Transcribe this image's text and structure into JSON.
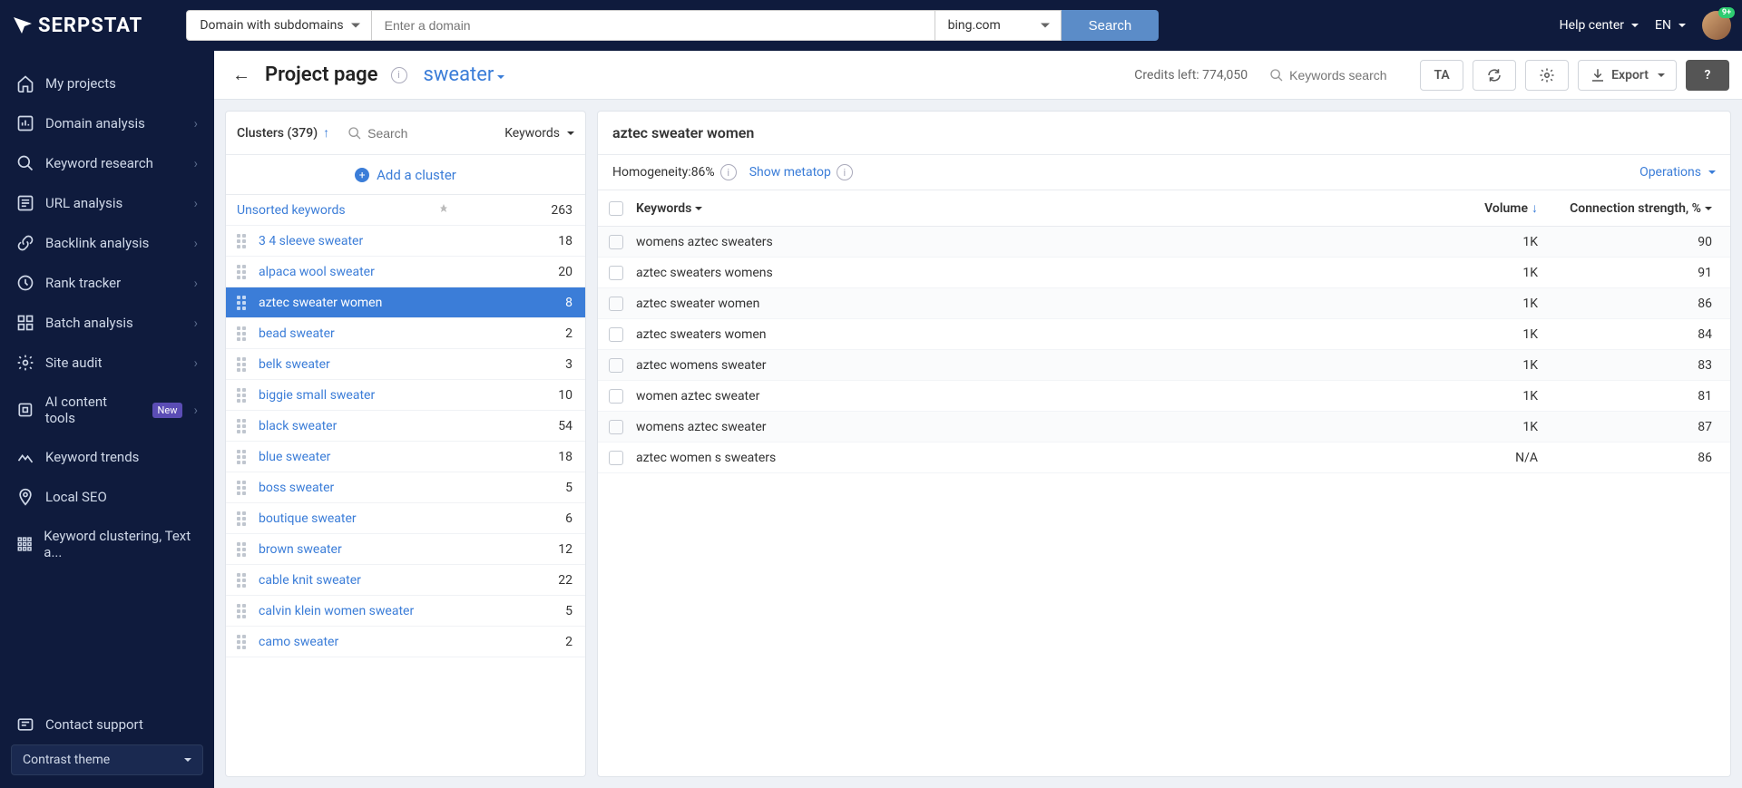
{
  "topbar": {
    "logo": "SERPSTAT",
    "domain_mode": "Domain with subdomains",
    "domain_placeholder": "Enter a domain",
    "engine": "bing.com",
    "search_btn": "Search",
    "help": "Help center",
    "lang": "EN",
    "badge": "9+"
  },
  "sidebar": {
    "items": [
      {
        "label": "My projects"
      },
      {
        "label": "Domain analysis",
        "chev": true
      },
      {
        "label": "Keyword research",
        "chev": true
      },
      {
        "label": "URL analysis",
        "chev": true
      },
      {
        "label": "Backlink analysis",
        "chev": true
      },
      {
        "label": "Rank tracker",
        "chev": true
      },
      {
        "label": "Batch analysis",
        "chev": true
      },
      {
        "label": "Site audit",
        "chev": true
      },
      {
        "label": "AI content tools",
        "chev": true,
        "new": true
      },
      {
        "label": "Keyword trends"
      },
      {
        "label": "Local SEO"
      },
      {
        "label": "Keyword clustering, Text a..."
      }
    ],
    "new_tag": "New",
    "contact": "Contact support",
    "contrast": "Contrast theme"
  },
  "toolbar": {
    "page_title": "Project page",
    "keyword": "sweater",
    "credits": "Credits left: 774,050",
    "kw_search_placeholder": "Keywords search",
    "ta_btn": "TA",
    "export": "Export"
  },
  "clusters": {
    "header": "Clusters (379)",
    "search_placeholder": "Search",
    "kw_col": "Keywords",
    "add": "Add a cluster",
    "unsorted_label": "Unsorted keywords",
    "unsorted_count": "263",
    "rows": [
      {
        "name": "3 4 sleeve sweater",
        "count": "18"
      },
      {
        "name": "alpaca wool sweater",
        "count": "20"
      },
      {
        "name": "aztec sweater women",
        "count": "8",
        "selected": true
      },
      {
        "name": "bead sweater",
        "count": "2"
      },
      {
        "name": "belk sweater",
        "count": "3"
      },
      {
        "name": "biggie small sweater",
        "count": "10"
      },
      {
        "name": "black sweater",
        "count": "54"
      },
      {
        "name": "blue sweater",
        "count": "18"
      },
      {
        "name": "boss sweater",
        "count": "5"
      },
      {
        "name": "boutique sweater",
        "count": "6"
      },
      {
        "name": "brown sweater",
        "count": "12"
      },
      {
        "name": "cable knit sweater",
        "count": "22"
      },
      {
        "name": "calvin klein women sweater",
        "count": "5"
      },
      {
        "name": "camo sweater",
        "count": "2"
      }
    ]
  },
  "detail": {
    "title": "aztec sweater women",
    "homogeneity_label": "Homogeneity: ",
    "homogeneity_value": "86%",
    "show_metatop": "Show metatop",
    "operations": "Operations",
    "col_kw": "Keywords",
    "col_vol": "Volume",
    "col_conn": "Connection strength, %",
    "rows": [
      {
        "kw": "womens aztec sweaters",
        "vol": "1K",
        "conn": "90"
      },
      {
        "kw": "aztec sweaters womens",
        "vol": "1K",
        "conn": "91"
      },
      {
        "kw": "aztec sweater women",
        "vol": "1K",
        "conn": "86"
      },
      {
        "kw": "aztec sweaters women",
        "vol": "1K",
        "conn": "84"
      },
      {
        "kw": "aztec womens sweater",
        "vol": "1K",
        "conn": "83"
      },
      {
        "kw": "women aztec sweater",
        "vol": "1K",
        "conn": "81"
      },
      {
        "kw": "womens aztec sweater",
        "vol": "1K",
        "conn": "87"
      },
      {
        "kw": "aztec women s sweaters",
        "vol": "N/A",
        "conn": "86"
      }
    ]
  }
}
